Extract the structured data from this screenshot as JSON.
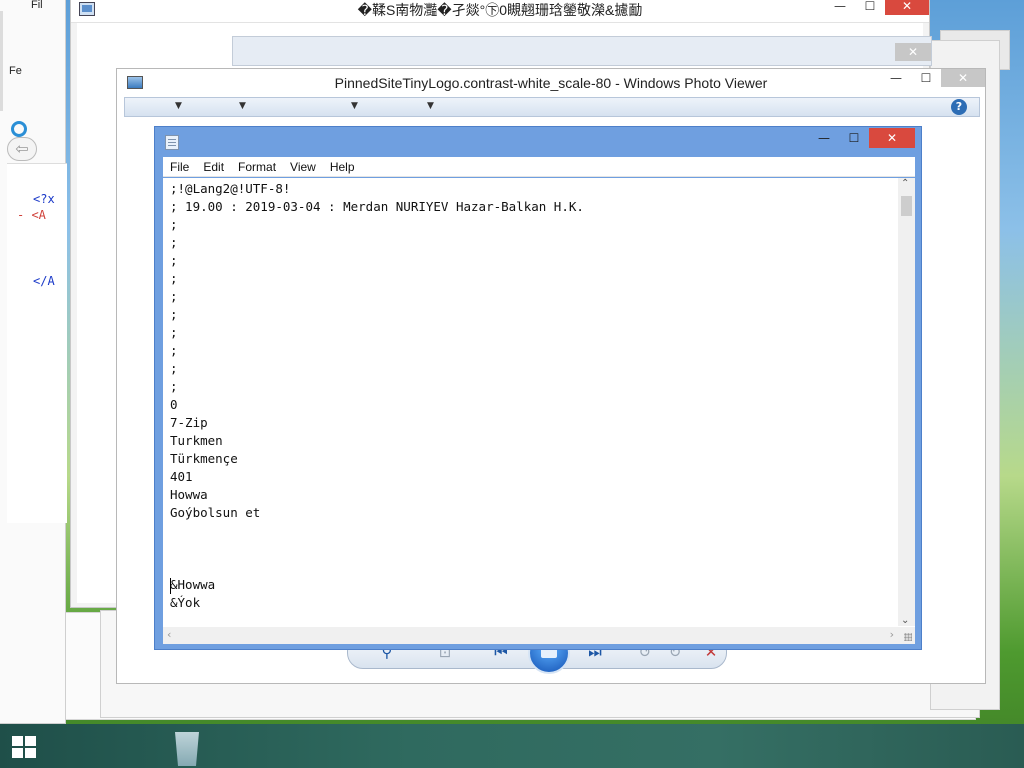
{
  "background_window": {
    "title": "�鞣S南物灩�孑燚°㊦0瞡翹珊琀鎣敬濚&攄勔",
    "controls": {
      "minimize": "—",
      "maximize": "☐",
      "close": "✕"
    }
  },
  "left_window": {
    "menu_file": "Fil",
    "menu_fe": "Fe",
    "xml_lines": [
      {
        "text": "<?x",
        "color": "#1a39c8"
      },
      {
        "text": "- <A",
        "color": "#d0413a"
      },
      {
        "text": "</A",
        "color": "#1a39c8"
      }
    ],
    "back_arrow": "⇦"
  },
  "stack_window": {
    "close": "✕"
  },
  "photo_viewer": {
    "title": "PinnedSiteTinyLogo.contrast-white_scale-80 - Windows Photo Viewer",
    "controls": {
      "minimize": "—",
      "maximize": "☐",
      "close": "✕"
    },
    "toolbar_dropdown_arrow": "▼",
    "help": "?",
    "bottom_buttons": {
      "zoom": "⚲",
      "fit": "⊡",
      "prev": "⏮",
      "next": "⏭",
      "rotate_ccw": "↺",
      "rotate_cw": "↻",
      "delete": "✕"
    }
  },
  "notepad": {
    "controls": {
      "minimize": "—",
      "maximize": "☐",
      "close": "✕"
    },
    "menu": {
      "file": "File",
      "edit": "Edit",
      "format": "Format",
      "view": "View",
      "help": "Help"
    },
    "lines": [
      ";!@Lang2@!UTF-8!",
      "; 19.00 : 2019-03-04 : Merdan NURIYEV Hazar-Balkan H.K.",
      ";",
      ";",
      ";",
      ";",
      ";",
      ";",
      ";",
      ";",
      ";",
      ";",
      "0",
      "7-Zip",
      "Turkmen",
      "Türkmençe",
      "401",
      "Howwa",
      "Goýbolsun et",
      "",
      "",
      "",
      "&Howwa",
      "&Ýok"
    ],
    "scroll_up": "⌃",
    "scroll_down": "⌄",
    "scroll_left": "‹",
    "scroll_right": "›"
  },
  "taskbar": {
    "start_color": "#ffffff"
  }
}
